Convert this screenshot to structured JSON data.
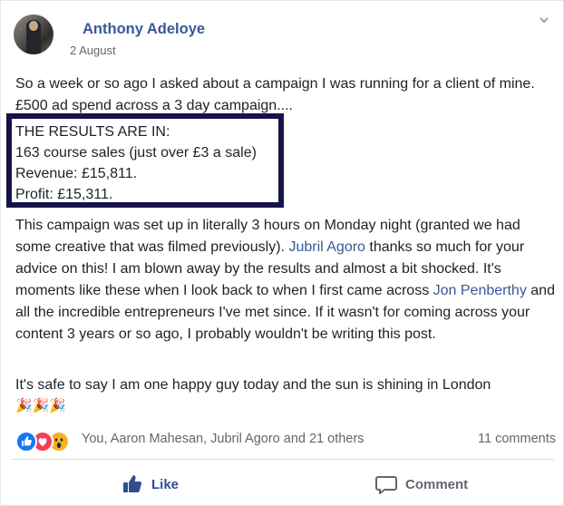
{
  "post": {
    "author": "Anthony Adeloye",
    "date": "2 August",
    "paragraph1": "So a week or so ago I asked about a campaign I was running for a client of mine. £500 ad spend across a 3 day campaign....",
    "results": {
      "line1": "THE RESULTS ARE IN:",
      "line2": "163 course sales (just over £3 a sale)",
      "line3": "Revenue: £15,811.",
      "line4": "Profit: £15,311."
    },
    "paragraph2": {
      "part1": "This campaign was set up in literally 3 hours on Monday night (granted we had some creative that was filmed previously). ",
      "mention1": "Jubril Agoro",
      "part2": " thanks so much for your advice on this! I am blown away by the results and almost a bit shocked. It's moments like these when I look back to when I first came across ",
      "mention2": "Jon Penberthy",
      "part3": " and all the incredible entrepreneurs I've met since. If it wasn't for coming across your content 3 years or so ago, I probably wouldn't be writing this post."
    },
    "paragraph3": "It's safe to say I am one happy guy today and the sun is shining in London",
    "emojis": "🎉🎉🎉"
  },
  "stats": {
    "reactions": [
      "like-icon",
      "love-icon",
      "wow-icon"
    ],
    "reactors": "You, Aaron Mahesan, Jubril Agoro and 21 others",
    "comments": "11 comments"
  },
  "actions": {
    "like_label": "Like",
    "comment_label": "Comment"
  },
  "colors": {
    "link": "#385898",
    "results_border": "#161349",
    "like_active": "#2e4e8f"
  }
}
